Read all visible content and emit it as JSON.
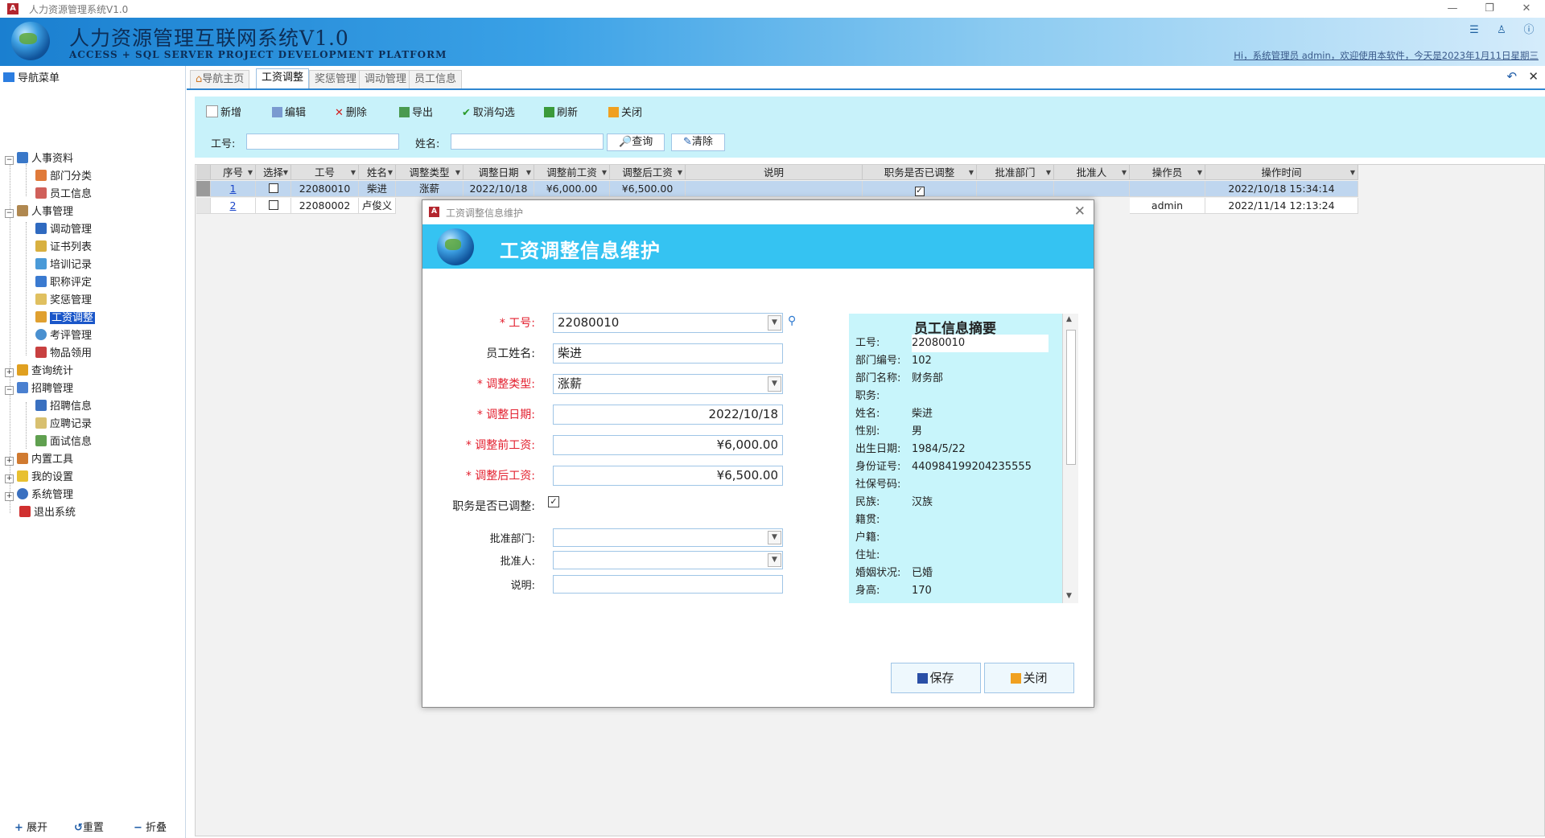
{
  "window": {
    "title": "人力资源管理系统V1.0",
    "app_badge": "A"
  },
  "header": {
    "system_name": "人力资源管理互联网系统V1.0",
    "system_name_en": "ACCESS + SQL SERVER PROJECT DEVELOPMENT PLATFORM",
    "welcome": "Hi，系统管理员 admin，欢迎使用本软件，今天是2023年1月11日星期三"
  },
  "nav": {
    "title": "导航菜单",
    "groups": [
      {
        "label": "人事资料",
        "items": [
          "部门分类",
          "员工信息"
        ]
      },
      {
        "label": "人事管理",
        "items": [
          "调动管理",
          "证书列表",
          "培训记录",
          "职称评定",
          "奖惩管理",
          "工资调整",
          "考评管理",
          "物品领用"
        ]
      },
      {
        "label": "查询统计"
      },
      {
        "label": "招聘管理",
        "items": [
          "招聘信息",
          "应聘记录",
          "面试信息"
        ]
      },
      {
        "label": "内置工具"
      },
      {
        "label": "我的设置"
      },
      {
        "label": "系统管理"
      },
      {
        "label": "退出系统"
      }
    ],
    "selected": "工资调整",
    "footer": {
      "expand": "展开",
      "reset": "重置",
      "collapse": "折叠"
    }
  },
  "tabs": [
    "导航主页",
    "工资调整",
    "奖惩管理",
    "调动管理",
    "员工信息"
  ],
  "active_tab": "工资调整",
  "toolbar": {
    "add": "新增",
    "edit": "编辑",
    "delete": "删除",
    "export": "导出",
    "uncheck": "取消勾选",
    "refresh": "刷新",
    "close": "关闭"
  },
  "search": {
    "emp_no_label": "工号:",
    "emp_no_value": "",
    "name_label": "姓名:",
    "name_value": "",
    "query": "查询",
    "clear": "清除"
  },
  "grid": {
    "columns": [
      "序号",
      "选择",
      "工号",
      "姓名",
      "调整类型",
      "调整日期",
      "调整前工资",
      "调整后工资",
      "说明",
      "职务是否已调整",
      "批准部门",
      "批准人",
      "操作员",
      "操作时间"
    ],
    "rows": [
      {
        "seq": "1",
        "checked": false,
        "emp_no": "22080010",
        "name": "柴进",
        "type": "涨薪",
        "date": "2022/10/18",
        "before": "¥6,000.00",
        "after": "¥6,500.00",
        "note": "",
        "adjusted": true,
        "dept": "",
        "approver": "",
        "operator": "",
        "time": "2022/10/18 15:34:14"
      },
      {
        "seq": "2",
        "checked": false,
        "emp_no": "22080002",
        "name": "卢俊义",
        "type": "",
        "date": "",
        "before": "",
        "after": "",
        "note": "",
        "adjusted": false,
        "dept": "",
        "approver": "",
        "operator": "admin",
        "time": "2022/11/14 12:13:24"
      }
    ]
  },
  "dialog": {
    "window_title": "工资调整信息维护",
    "heading": "工资调整信息维护",
    "fields": {
      "emp_no": {
        "label": "工号:",
        "value": "22080010"
      },
      "emp_name": {
        "label": "员工姓名:",
        "value": "柴进"
      },
      "adj_type": {
        "label": "调整类型:",
        "value": "涨薪"
      },
      "adj_date": {
        "label": "调整日期:",
        "value": "2022/10/18"
      },
      "before": {
        "label": "调整前工资:",
        "value": "¥6,000.00"
      },
      "after": {
        "label": "调整后工资:",
        "value": "¥6,500.00"
      },
      "adjusted": {
        "label": "职务是否已调整:",
        "checked": true
      },
      "dept": {
        "label": "批准部门:",
        "value": ""
      },
      "approver": {
        "label": "批准人:",
        "value": ""
      },
      "note": {
        "label": "说明:",
        "value": ""
      }
    },
    "required_mark": "*",
    "summary": {
      "title": "员工信息摘要",
      "rows": [
        {
          "k": "工号:",
          "v": "22080010"
        },
        {
          "k": "部门编号:",
          "v": "102"
        },
        {
          "k": "部门名称:",
          "v": "财务部"
        },
        {
          "k": "职务:",
          "v": ""
        },
        {
          "k": "姓名:",
          "v": "柴进"
        },
        {
          "k": "性别:",
          "v": "男"
        },
        {
          "k": "出生日期:",
          "v": "1984/5/22"
        },
        {
          "k": "身份证号:",
          "v": "440984199204235555"
        },
        {
          "k": "社保号码:",
          "v": ""
        },
        {
          "k": "民族:",
          "v": "汉族"
        },
        {
          "k": "籍贯:",
          "v": ""
        },
        {
          "k": "户籍:",
          "v": ""
        },
        {
          "k": "住址:",
          "v": ""
        },
        {
          "k": "婚姻状况:",
          "v": "已婚"
        },
        {
          "k": "身高:",
          "v": "170"
        }
      ]
    },
    "save": "保存",
    "close": "关闭"
  }
}
